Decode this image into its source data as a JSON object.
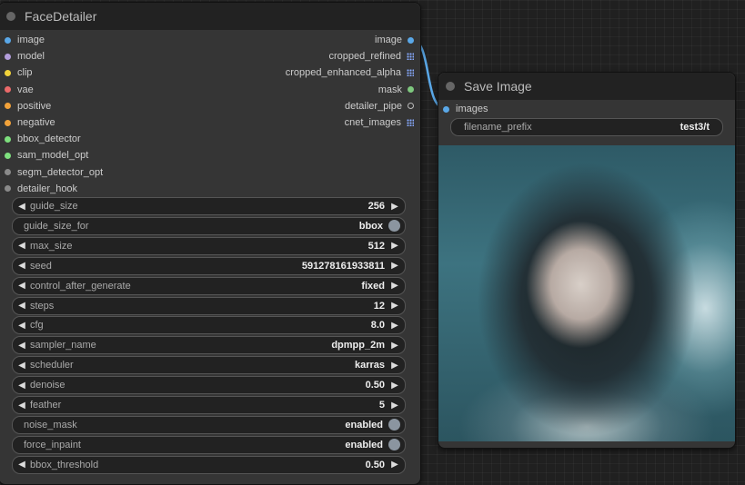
{
  "face_detailer": {
    "title": "FaceDetailer",
    "inputs": [
      {
        "label": "image",
        "color": "#5aa8e8"
      },
      {
        "label": "model",
        "color": "#b39ddb"
      },
      {
        "label": "clip",
        "color": "#f2d33a"
      },
      {
        "label": "vae",
        "color": "#ec6a6a"
      },
      {
        "label": "positive",
        "color": "#f2a23a"
      },
      {
        "label": "negative",
        "color": "#f2a23a"
      },
      {
        "label": "bbox_detector",
        "color": "#7ee07e"
      },
      {
        "label": "sam_model_opt",
        "color": "#7ee07e"
      },
      {
        "label": "segm_detector_opt",
        "color": "#8a8a8a"
      },
      {
        "label": "detailer_hook",
        "color": "#8a8a8a"
      }
    ],
    "outputs": [
      {
        "label": "image",
        "icon": "dot",
        "color": "#5aa8e8"
      },
      {
        "label": "cropped_refined",
        "icon": "grid",
        "color": "#88aaff"
      },
      {
        "label": "cropped_enhanced_alpha",
        "icon": "grid",
        "color": "#88aaff"
      },
      {
        "label": "mask",
        "icon": "dot",
        "color": "#7ec87e"
      },
      {
        "label": "detailer_pipe",
        "icon": "ring",
        "color": "#bbbbbb"
      },
      {
        "label": "cnet_images",
        "icon": "grid",
        "color": "#88aaff"
      }
    ],
    "widgets": [
      {
        "name": "guide_size",
        "value": "256",
        "type": "number"
      },
      {
        "name": "guide_size_for",
        "value": "bbox",
        "type": "toggle"
      },
      {
        "name": "max_size",
        "value": "512",
        "type": "number"
      },
      {
        "name": "seed",
        "value": "591278161933811",
        "type": "number"
      },
      {
        "name": "control_after_generate",
        "value": "fixed",
        "type": "combo"
      },
      {
        "name": "steps",
        "value": "12",
        "type": "number"
      },
      {
        "name": "cfg",
        "value": "8.0",
        "type": "number"
      },
      {
        "name": "sampler_name",
        "value": "dpmpp_2m",
        "type": "combo"
      },
      {
        "name": "scheduler",
        "value": "karras",
        "type": "combo"
      },
      {
        "name": "denoise",
        "value": "0.50",
        "type": "number"
      },
      {
        "name": "feather",
        "value": "5",
        "type": "number"
      },
      {
        "name": "noise_mask",
        "value": "enabled",
        "type": "toggle"
      },
      {
        "name": "force_inpaint",
        "value": "enabled",
        "type": "toggle"
      },
      {
        "name": "bbox_threshold",
        "value": "0.50",
        "type": "number"
      }
    ]
  },
  "save_image": {
    "title": "Save Image",
    "input_label": "images",
    "input_color": "#5aa8e8",
    "filename_prefix": {
      "name": "filename_prefix",
      "value": "test3/t"
    }
  },
  "icons": {
    "left_arrow": "◀",
    "right_arrow": "▶"
  }
}
